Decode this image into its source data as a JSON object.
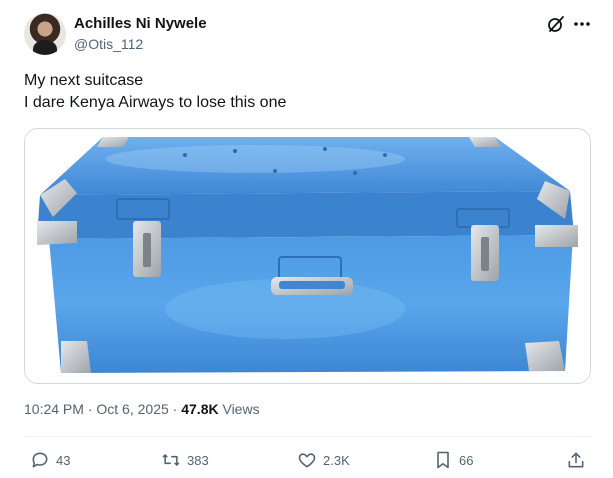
{
  "author": {
    "name": "Achilles Ni Nywele",
    "handle": "@Otis_112",
    "avatar_icon": "profile-photo"
  },
  "header_icons": [
    "grok-icon",
    "more-icon"
  ],
  "tweet": {
    "lines": [
      "My next suitcase",
      "I dare Kenya Airways to lose this one"
    ]
  },
  "media": {
    "description_icon": "blue-metal-trunk-image"
  },
  "meta": {
    "time": "10:24 PM",
    "separator": "·",
    "date": "Oct 6, 2025",
    "views_count": "47.8K",
    "views_label": "Views"
  },
  "actions": {
    "replies": "43",
    "reposts": "383",
    "likes": "2.3K",
    "bookmarks": "66"
  },
  "colors": {
    "text": "#0f1419",
    "secondary": "#536471",
    "border": "#cfd9de",
    "trunk_blue": "#4a90d9"
  }
}
